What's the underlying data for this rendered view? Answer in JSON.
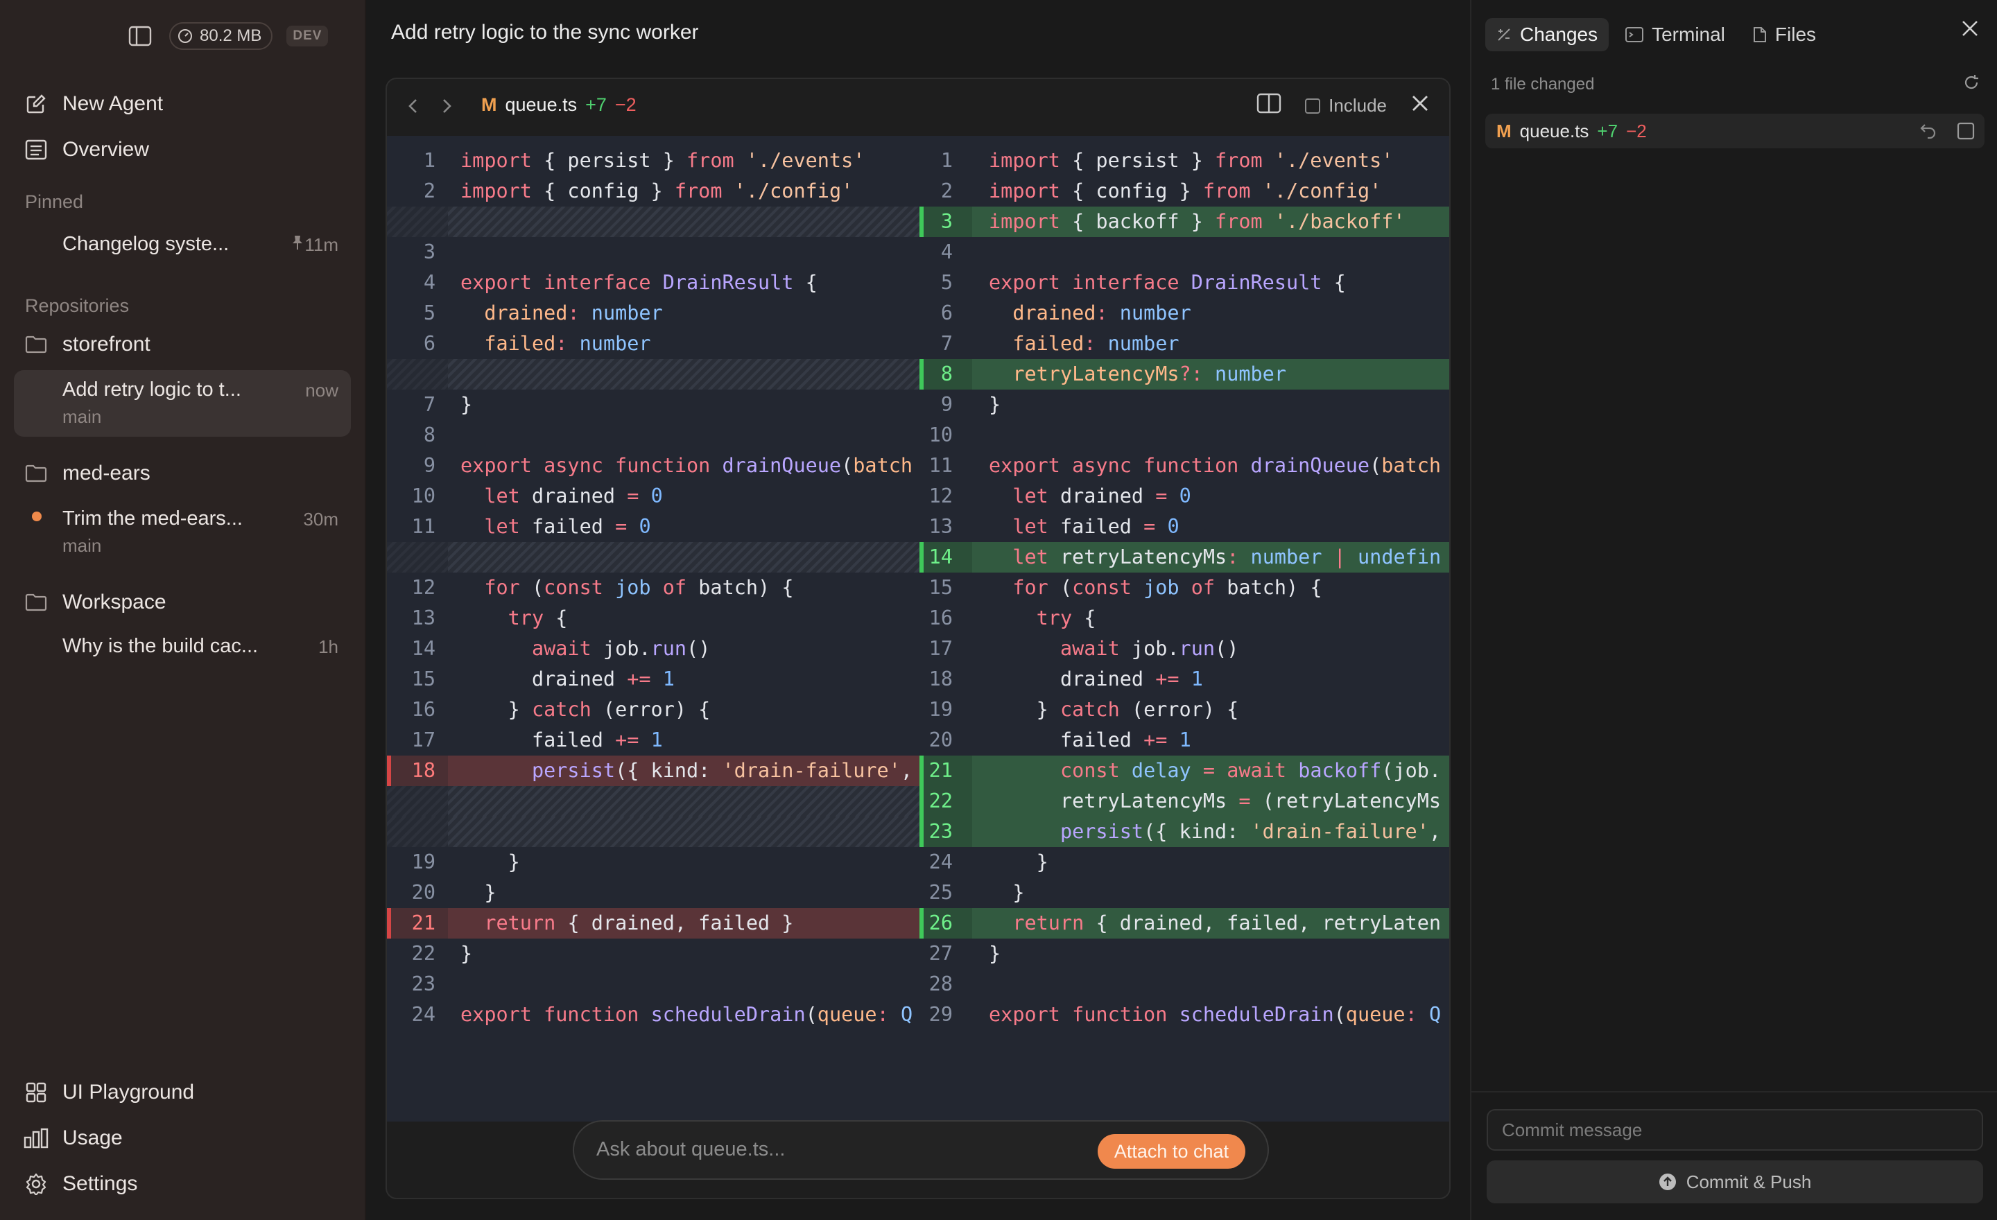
{
  "sidebar": {
    "memory": "80.2 MB",
    "dev_badge": "DEV",
    "nav": {
      "new_agent": "New Agent",
      "overview": "Overview"
    },
    "pinned_label": "Pinned",
    "pinned": [
      {
        "title": "Changelog syste...",
        "time": "11m"
      }
    ],
    "repositories_label": "Repositories",
    "repos": [
      {
        "name": "storefront",
        "threads": [
          {
            "title": "Add retry logic to t...",
            "branch": "main",
            "time": "now"
          }
        ]
      },
      {
        "name": "med-ears",
        "threads": [
          {
            "title": "Trim the med-ears...",
            "branch": "main",
            "time": "30m"
          }
        ]
      },
      {
        "name": "Workspace",
        "threads": [
          {
            "title": "Why is the build cac...",
            "time": "1h"
          }
        ]
      }
    ],
    "bottom": {
      "playground": "UI Playground",
      "usage": "Usage",
      "settings": "Settings"
    }
  },
  "main": {
    "title": "Add retry logic to the sync worker",
    "diff": {
      "status": "M",
      "filename": "queue.ts",
      "additions": "+7",
      "deletions": "−2",
      "include_label": "Include"
    },
    "chat": {
      "placeholder": "Ask about queue.ts...",
      "attach_label": "Attach to chat"
    }
  },
  "right": {
    "tabs": {
      "changes": "Changes",
      "terminal": "Terminal",
      "files": "Files"
    },
    "files_changed": "1 file changed",
    "file": {
      "status": "M",
      "name": "queue.ts",
      "additions": "+7",
      "deletions": "−2"
    },
    "commit_placeholder": "Commit message",
    "commit_button": "Commit & Push"
  },
  "colors": {
    "accent": "#f0884d",
    "added": "#4fd16f",
    "removed": "#ef5f5f",
    "modified": "#f0a050"
  }
}
